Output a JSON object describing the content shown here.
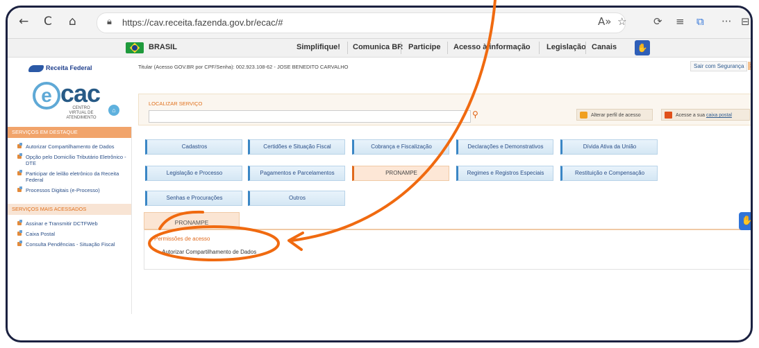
{
  "browser": {
    "url": "https://cav.receita.fazenda.gov.br/ecac/#",
    "back": "←",
    "reload": "C",
    "home": "⌂",
    "lock": "🔒",
    "icons": [
      "A⁾",
      "☆",
      "⟳",
      "≡",
      "⧉",
      "···",
      "⊟"
    ]
  },
  "govbar": {
    "country": "BRASIL",
    "links": [
      "Simplifique!",
      "Comunica BR",
      "Participe",
      "Acesso à informação",
      "Legislação",
      "Canais"
    ]
  },
  "header": {
    "org": "Receita Federal",
    "logo_text": "cac",
    "logo_sub": "CENTRO VIRTUAL DE ATENDIMENTO",
    "titular": "Titular (Acesso GOV.BR por CPF/Senha): 002.923.108-62 - JOSE BENEDITO CARVALHO",
    "logout": "Sair com Segurança",
    "logout_x": "x"
  },
  "search": {
    "label": "LOCALIZAR SERVIÇO",
    "value": "",
    "perfil_label": "Alterar perfil de acesso",
    "caixa_prefix": "Acesse a sua ",
    "caixa_link": "caixa postal"
  },
  "sidebar": {
    "destaque_title": "SERVIÇOS EM DESTAQUE",
    "destaque": [
      "Autorizar Compartilhamento de Dados",
      "Opção pelo Domicílio Tributário Eletrônico - DTE",
      "Participar de leilão eletrônico da Receita Federal",
      "Processos Digitais (e-Processo)"
    ],
    "acessados_title": "SERVIÇOS MAIS ACESSADOS",
    "acessados": [
      "Assinar e Transmitir DCTFWeb",
      "Caixa Postal",
      "Consulta Pendências - Situação Fiscal"
    ]
  },
  "categories": [
    "Cadastros",
    "Certidões e Situação Fiscal",
    "Cobrança e Fiscalização",
    "Declarações e Demonstrativos",
    "Dívida Ativa da União",
    "Legislação e Processo",
    "Pagamentos e Parcelamentos",
    "PRONAMPE",
    "Regimes e Registros Especiais",
    "Restituição e Compensação",
    "Senhas e Procurações",
    "Outros"
  ],
  "active_category": "PRONAMPE",
  "panel": {
    "tab_label": "PRONAMPE",
    "section_title": "Permissões de acesso",
    "item": "Autorizar Compartilhamento de Dados"
  },
  "colors": {
    "annotation": "#f06a10",
    "accent_orange": "#e06a1d",
    "link_blue": "#2a4e87"
  }
}
